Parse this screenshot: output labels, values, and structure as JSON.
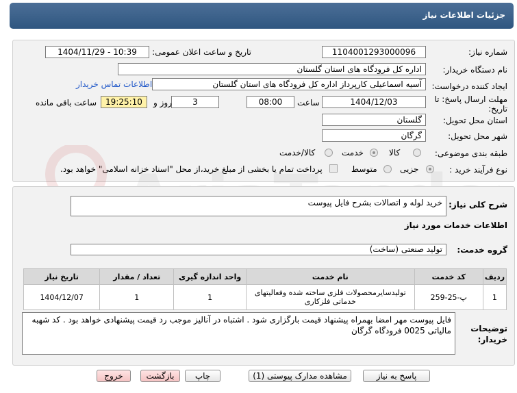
{
  "header": {
    "title": "جزئیات اطلاعات نیاز"
  },
  "form": {
    "need_number_label": "شماره نیاز:",
    "need_number": "1104001293000096",
    "announce_label": "تاریخ و ساعت اعلان عمومی:",
    "announce_value": "1404/11/29 - 10:39",
    "buyer_org_label": "نام دستگاه خریدار:",
    "buyer_org": "اداره کل فرودگاه های استان گلستان",
    "creator_label": "ایجاد کننده درخواست:",
    "creator": "آسیه اسماعیلی کارپرداز اداره کل فرودگاه های استان گلستان",
    "contact_link": "اطلاعات تماس خریدار",
    "deadline_label": "مهلت ارسال پاسخ: تا تاریخ:",
    "deadline_date": "1404/12/03",
    "time_label": "ساعت",
    "deadline_time": "08:00",
    "days_value": "3",
    "days_label": "روز و",
    "remaining_time": "19:25:10",
    "remaining_label": "ساعت باقی مانده",
    "province_label": "استان محل تحویل:",
    "province": "گلستان",
    "city_label": "شهر محل تحویل:",
    "city": "گرگان",
    "category_label": "طبقه بندی موضوعی:",
    "category_options": [
      "کالا",
      "خدمت",
      "کالا/خدمت"
    ],
    "process_label": "نوع فرآیند خرید :",
    "process_options": [
      "جزیی",
      "متوسط"
    ],
    "payment_note": "پرداخت تمام یا بخشی از مبلغ خرید،از محل \"اسناد خزانه اسلامی\" خواهد بود."
  },
  "need": {
    "summary_label": "شرح کلی نیاز:",
    "summary": "خرید لوله و اتصالات بشرح فایل پیوست",
    "services_title": "اطلاعات خدمات مورد نیاز",
    "service_group_label": "گروه خدمت:",
    "service_group": "تولید صنعتی (ساخت)"
  },
  "table": {
    "headers": [
      "ردیف",
      "کد خدمت",
      "نام خدمت",
      "واحد اندازه گیری",
      "تعداد / مقدار",
      "تاریخ نیاز"
    ],
    "rows": [
      [
        "1",
        "پ-25-259",
        "تولیدسایرمحصولات فلزی ساخته شده وفعالیتهای خدماتی فلزکاری",
        "1",
        "1",
        "1404/12/07"
      ]
    ]
  },
  "buyer_notes": {
    "label": "توضیحات خریدار:",
    "text": "فایل پیوست مهر امضا بهمراه پیشنهاد قیمت بارگزاری شود . اشتباه در آنالیز موجب رد قیمت پیشنهادی خواهد بود . کد شهبه مالیاتی 0025 فرودگاه گرگان"
  },
  "buttons": {
    "reply": "پاسخ به نیاز",
    "docs": "مشاهده مدارک پیوستی (1)",
    "print": "چاپ",
    "back": "بازگشت",
    "exit": "خروج"
  },
  "watermark": {
    "text": "AriaTender.net"
  },
  "colors": {
    "header": "#3a6189",
    "link": "#1e56c8",
    "remaining_bg": "#fff2a8",
    "exit_bg": "#f4c2c2"
  }
}
